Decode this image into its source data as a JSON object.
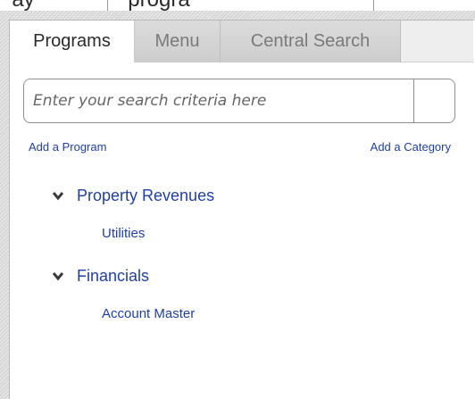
{
  "header_fragment": {
    "text": "  ay              ' progra"
  },
  "tabs": [
    {
      "label": "Programs",
      "active": true
    },
    {
      "label": "Menu",
      "active": false
    },
    {
      "label": "Central Search",
      "active": false
    }
  ],
  "search": {
    "placeholder": "Enter your search criteria here",
    "value": ""
  },
  "actions": {
    "add_program": "Add a Program",
    "add_category": "Add a Category"
  },
  "tree": {
    "categories": [
      {
        "label": "Property Revenues",
        "expanded": true,
        "items": [
          "Utilities"
        ]
      },
      {
        "label": "Financials",
        "expanded": true,
        "items": [
          "Account Master"
        ]
      }
    ]
  },
  "colors": {
    "link": "#1f3fa8",
    "active_tab_text": "#2a2a2a",
    "inactive_tab_text": "#7a7a7a"
  },
  "icons": {
    "expand": "chevron-down-icon",
    "search_submit": "search-icon"
  }
}
